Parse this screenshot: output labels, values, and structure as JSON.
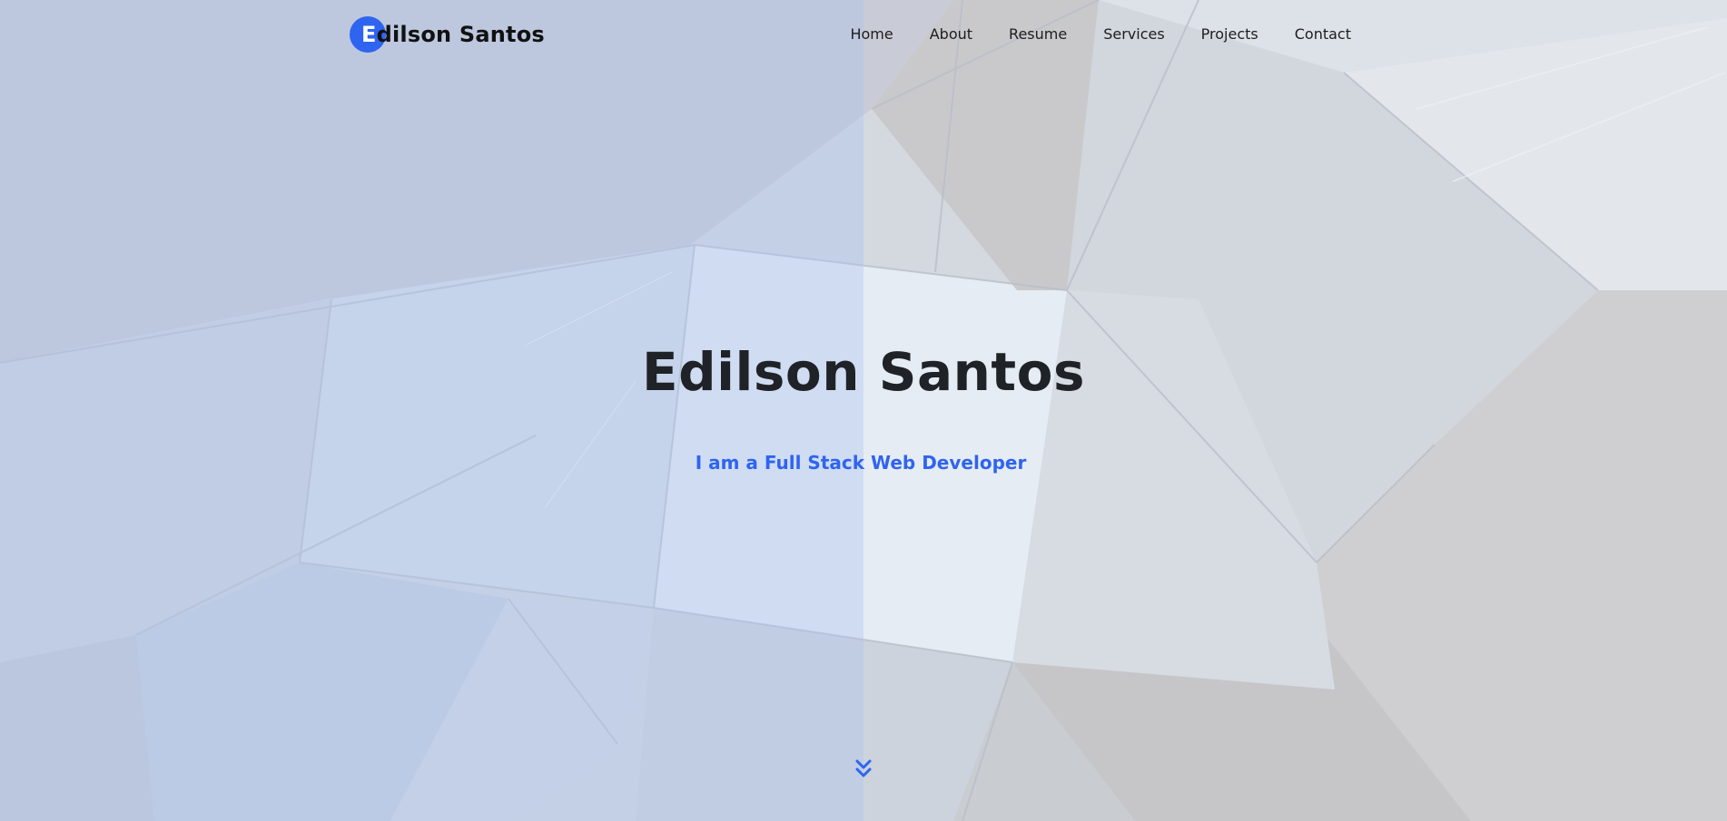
{
  "brand": {
    "first_letter": "E",
    "rest": "dilson Santos",
    "accent_color": "#2f64f0"
  },
  "nav": {
    "items": [
      {
        "label": "Home"
      },
      {
        "label": "About"
      },
      {
        "label": "Resume"
      },
      {
        "label": "Services"
      },
      {
        "label": "Projects"
      },
      {
        "label": "Contact"
      }
    ]
  },
  "hero": {
    "title": "Edilson Santos",
    "subtitle": "I am a Full Stack Web Developer",
    "scroll_icon": "double-chevron-down-icon"
  }
}
